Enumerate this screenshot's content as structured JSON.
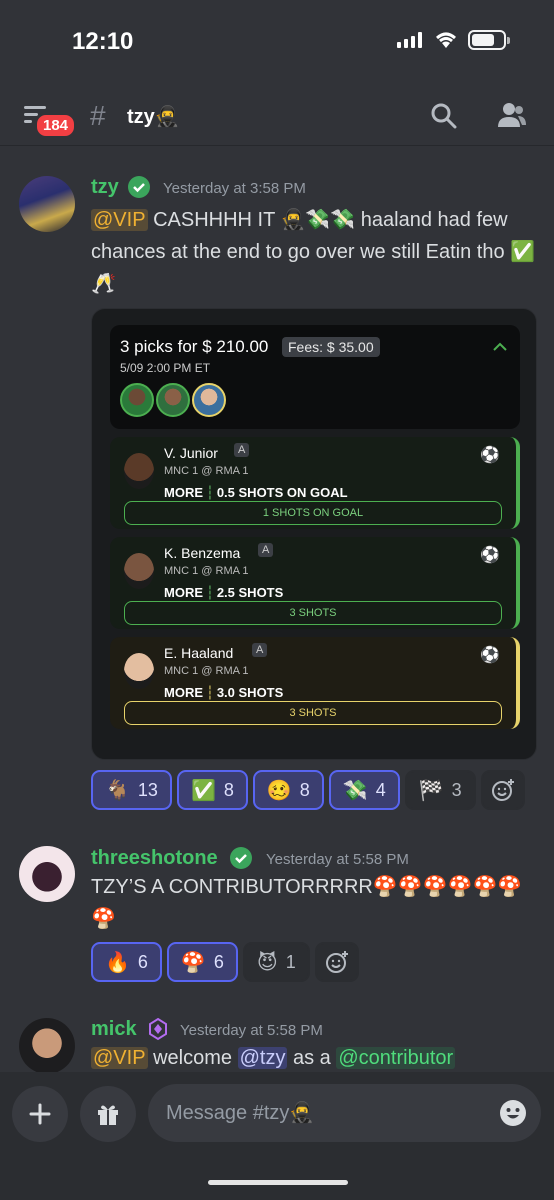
{
  "status": {
    "time": "12:10"
  },
  "header": {
    "unread_badge": "184",
    "channel_name": "tzy🥷"
  },
  "messages": [
    {
      "user": "tzy",
      "timestamp": "Yesterday at 3:58 PM",
      "mention": "@VIP",
      "text": " CASHHHH IT 🥷💸💸 haaland had few chances at the end to go over we still Eatin tho ✅🥂",
      "embed": {
        "title": "3 picks for $ 210.00",
        "fees": "Fees: $ 35.00",
        "date": "5/09 2:00 PM ET",
        "picks": [
          {
            "name": "V. Junior",
            "tag": "A",
            "match": "MNC 1 @ RMA 1",
            "stat": "0.5 SHOTS ON GOAL",
            "result": "1 SHOTS ON GOAL",
            "more": "MORE"
          },
          {
            "name": "K. Benzema",
            "tag": "A",
            "match": "MNC 1 @ RMA 1",
            "stat": "2.5 SHOTS",
            "result": "3 SHOTS",
            "more": "MORE"
          },
          {
            "name": "E. Haaland",
            "tag": "A",
            "match": "MNC 1 @ RMA 1",
            "stat": "3.0 SHOTS",
            "result": "3 SHOTS",
            "more": "MORE"
          }
        ]
      },
      "reactions": [
        {
          "emoji": "🐐",
          "count": "13"
        },
        {
          "emoji": "✅",
          "count": "8"
        },
        {
          "emoji": "🥴",
          "count": "8"
        },
        {
          "emoji": "💸",
          "count": "4"
        },
        {
          "emoji": "🏁",
          "count": "3"
        }
      ]
    },
    {
      "user": "threeshotone",
      "timestamp": "Yesterday at 5:58 PM",
      "text": "TZY’S A CONTRIBUTORRRRR🍄🍄🍄🍄🍄🍄🍄",
      "reactions": [
        {
          "emoji": "🔥",
          "count": "6"
        },
        {
          "emoji": "🍄",
          "count": "6"
        },
        {
          "emoji": "😈",
          "count": "1"
        }
      ]
    },
    {
      "user": "mick",
      "timestamp": "Yesterday at 5:58 PM",
      "mention_vip": "@VIP",
      "text_a": " welcome ",
      "mention_user": "@tzy",
      "text_b": " as a ",
      "mention_role": "@contributor"
    }
  ],
  "composer": {
    "placeholder": "Message #tzy🥷"
  },
  "colors": {
    "background": "#313338",
    "username": "#45c46b",
    "mention": "#5865f2",
    "badge": "#f23f43"
  }
}
